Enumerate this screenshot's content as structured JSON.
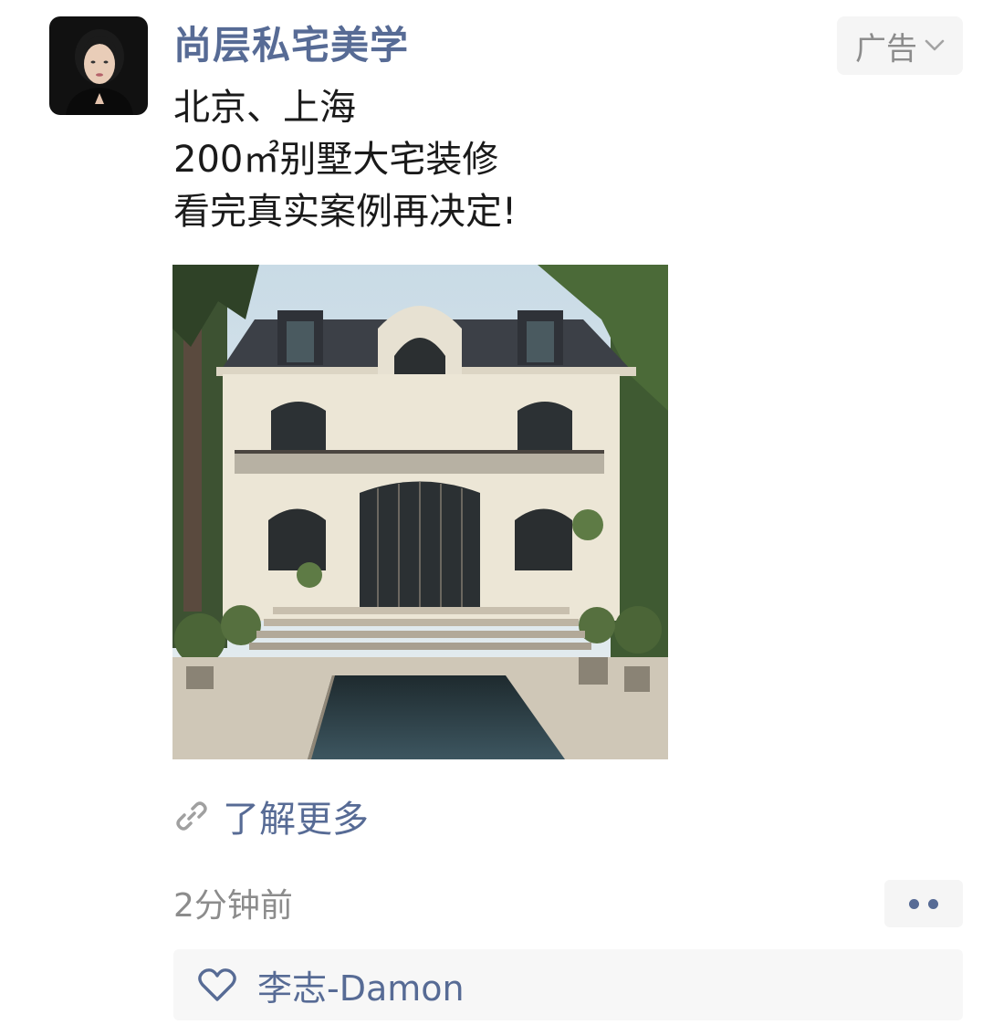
{
  "post": {
    "author": "尚层私宅美学",
    "ad_label": "广告",
    "text_lines": [
      "北京、上海",
      "200㎡别墅大宅装修",
      "看完真实案例再决定!"
    ],
    "learn_more": "了解更多",
    "timestamp": "2分钟前",
    "likes": [
      "李志-Damon"
    ]
  },
  "icons": {
    "ad_menu": "chevron-down-icon",
    "link": "link-icon",
    "more": "more-dots-icon",
    "like": "heart-icon"
  },
  "colors": {
    "name_blue": "#576b95",
    "text": "#1a1a1a",
    "muted": "#8c8c8c",
    "badge_bg": "#f5f5f5",
    "likes_bg": "#f7f7f7"
  }
}
